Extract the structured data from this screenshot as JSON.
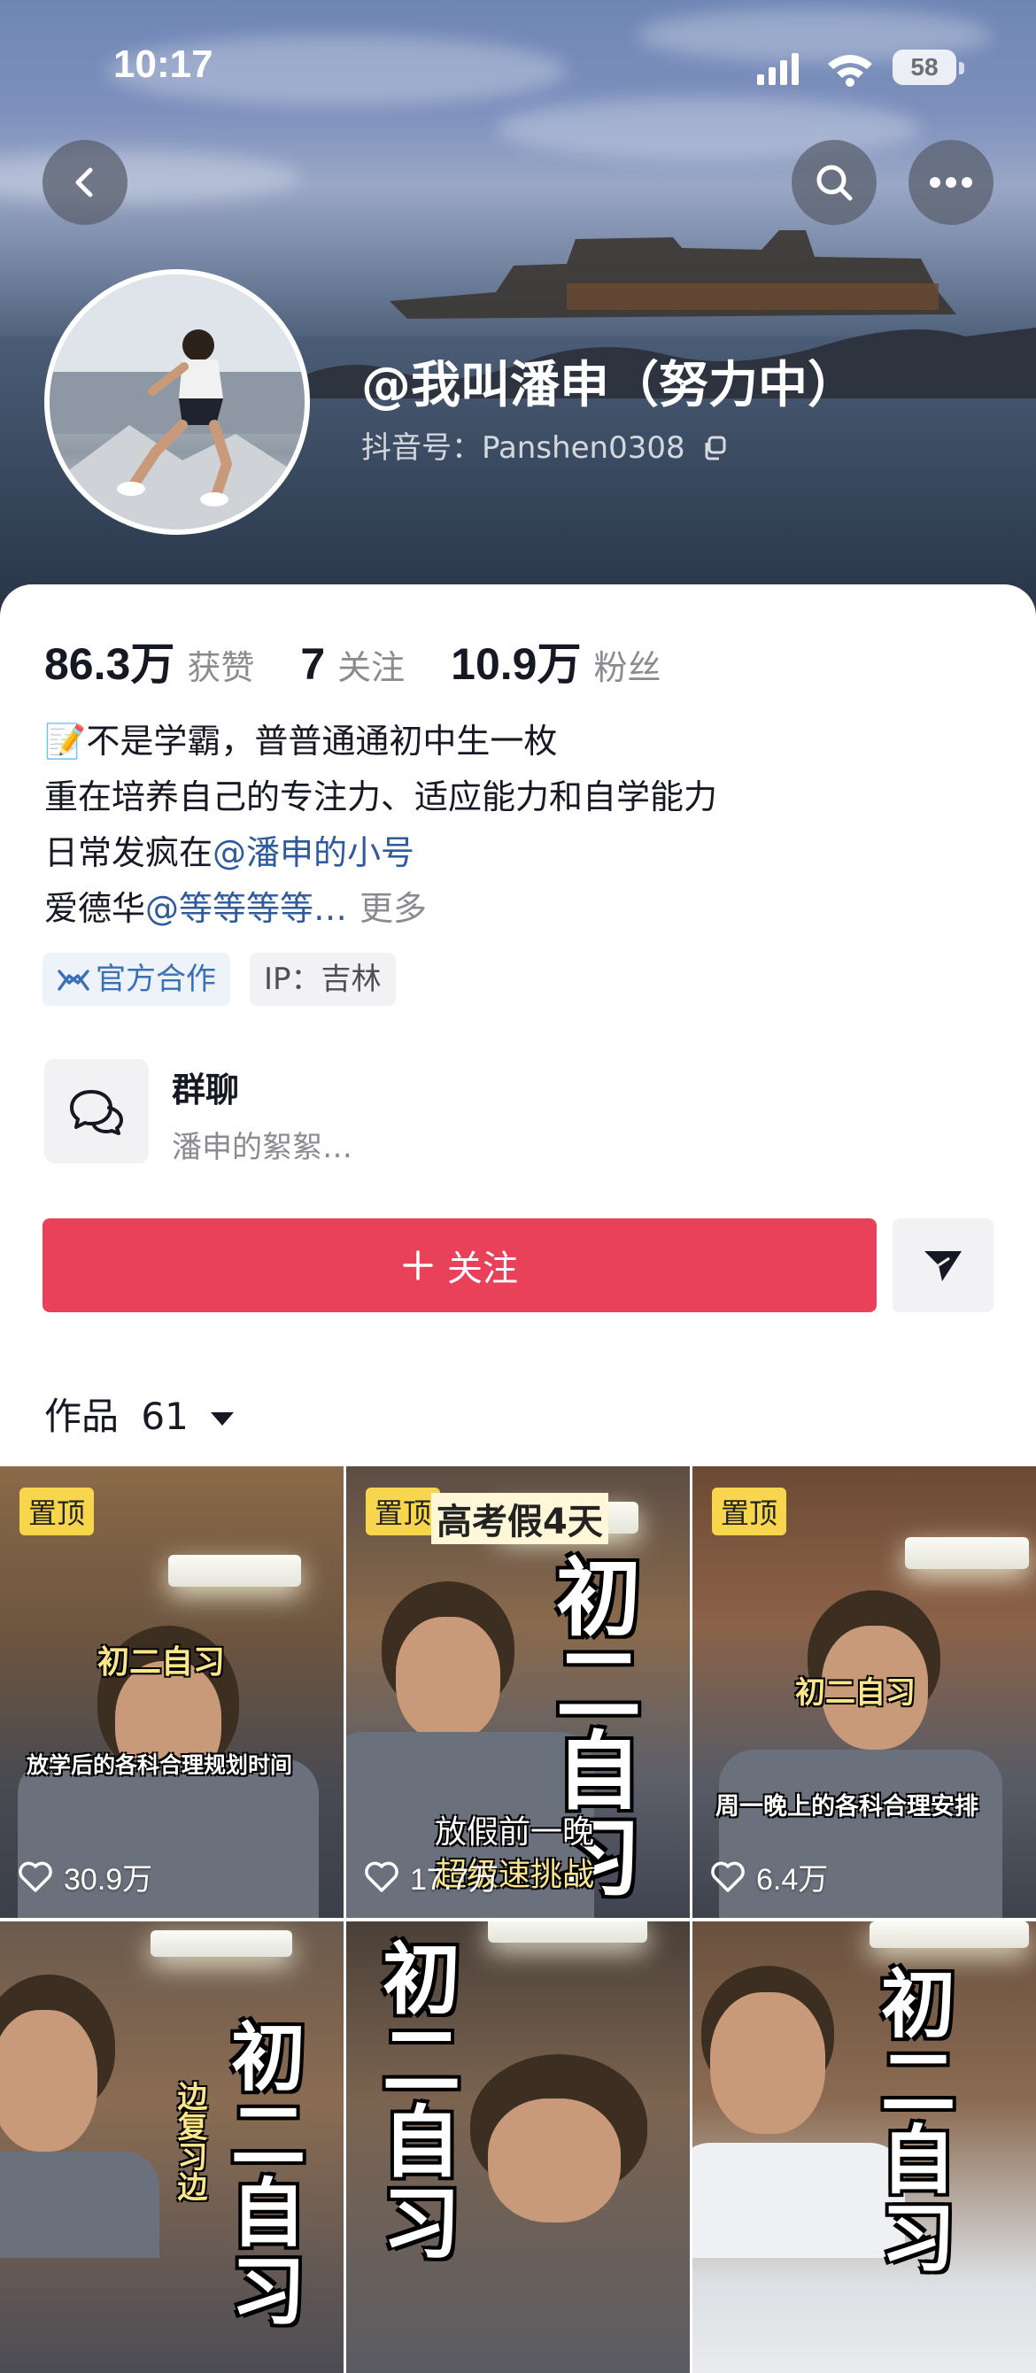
{
  "status_bar": {
    "time": "10:17",
    "battery": "58"
  },
  "profile": {
    "name": "@我叫潘申（努力中）",
    "douyin_id": "抖音号：Panshen0308"
  },
  "stats": [
    {
      "value": "86.3万",
      "label": "获赞"
    },
    {
      "value": "7",
      "label": "关注"
    },
    {
      "value": "10.9万",
      "label": "粉丝"
    }
  ],
  "bio": {
    "line1": "📝不是学霸，普普通通初中生一枚",
    "line2": "重在培养自己的专注力、适应能力和自学能力",
    "line3_prefix": "日常发疯在",
    "line3_mention": "@潘申的小号",
    "line4_prefix": "爱德华",
    "line4_mention": "@等等等等…",
    "more": "更多"
  },
  "tags": {
    "official": "官方合作",
    "ip": "IP：吉林"
  },
  "group": {
    "title": "群聊",
    "subtitle": "潘申的絮絮…"
  },
  "actions": {
    "follow": "关注"
  },
  "works": {
    "label": "作品",
    "count": "61"
  },
  "videos": [
    {
      "pinned": "置顶",
      "likes": "30.9万",
      "caption_title": "初二自习",
      "caption_sub": "放学后的各科合理规划时间"
    },
    {
      "pinned": "置顶",
      "likes": "17.7万",
      "caption_top": "高考假4天",
      "caption_vertical": "初二自习",
      "caption_bottom1": "放假前一晚",
      "caption_bottom2": "超级速挑战"
    },
    {
      "pinned": "置顶",
      "likes": "6.4万",
      "caption_title": "初二自习",
      "caption_sub": "周一晚上的各科合理安排"
    },
    {
      "caption_vertical": "初二自习",
      "caption_side": "边复习边"
    },
    {
      "caption_vertical": "初二自习"
    },
    {
      "caption_vertical": "初二自习"
    }
  ]
}
